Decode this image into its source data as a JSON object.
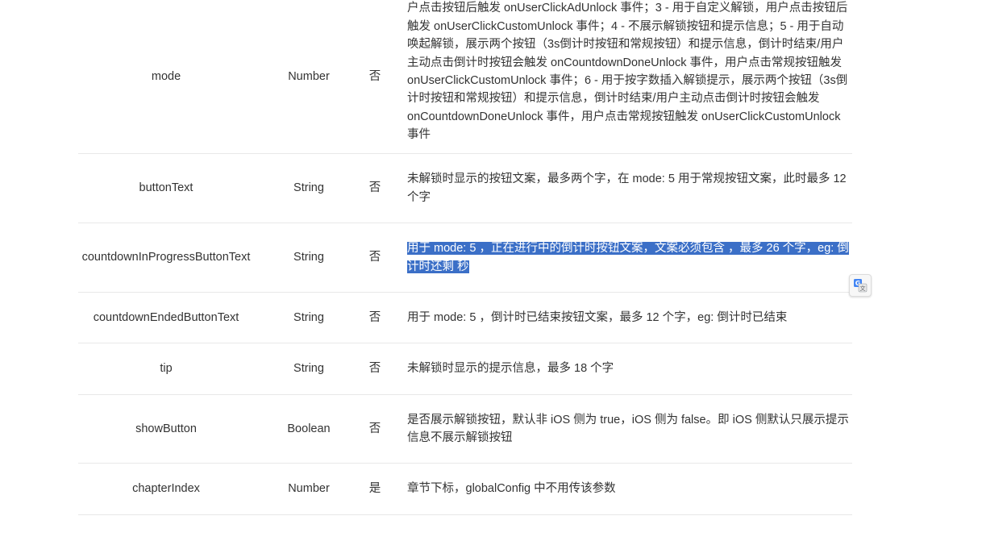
{
  "rows": [
    {
      "name": "mode",
      "type": "Number",
      "required": "否",
      "desc": "户点击按钮后触发 onUserClickAdUnlock 事件；3 - 用于自定义解锁，用户点击按钮后触发 onUserClickCustomUnlock 事件；4 - 不展示解锁按钮和提示信息；5 - 用于自动唤起解锁，展示两个按钮（3s倒计时按钮和常规按钮）和提示信息，倒计时结束/用户主动点击倒计时按钮会触发 onCountdownDoneUnlock 事件，用户点击常规按钮触发 onUserClickCustomUnlock 事件；6 - 用于按字数插入解锁提示，展示两个按钮（3s倒计时按钮和常规按钮）和提示信息，倒计时结束/用户主动点击倒计时按钮会触发 onCountdownDoneUnlock 事件，用户点击常规按钮触发 onUserClickCustomUnlock 事件"
    },
    {
      "name": "buttonText",
      "type": "String",
      "required": "否",
      "desc": "未解锁时显示的按钮文案，最多两个字，在 mode: 5 用于常规按钮文案，此时最多 12 个字"
    },
    {
      "name": "countdownInProgressButtonText",
      "type": "String",
      "required": "否",
      "desc": "用于 mode: 5 ，正在进行中的倒计时按钮文案，文案必须包含 ，最多 26 个字，eg: 倒计时还剩  秒"
    },
    {
      "name": "countdownEndedButtonText",
      "type": "String",
      "required": "否",
      "desc": "用于 mode: 5 ，倒计时已结束按钮文案，最多 12 个字，eg: 倒计时已结束"
    },
    {
      "name": "tip",
      "type": "String",
      "required": "否",
      "desc": "未解锁时显示的提示信息，最多 18 个字"
    },
    {
      "name": "showButton",
      "type": "Boolean",
      "required": "否",
      "desc": "是否展示解锁按钮，默认非 iOS 侧为 true，iOS 侧为 false。即 iOS 侧默认只展示提示信息不展示解锁按钮"
    },
    {
      "name": "chapterIndex",
      "type": "Number",
      "required": "是",
      "desc": "章节下标，globalConfig 中不用传该参数"
    }
  ],
  "colors": {
    "selection": "#3b6fc7",
    "text": "#333333",
    "border": "#e8e8e8"
  },
  "icons": {
    "translate": "translate-icon"
  }
}
